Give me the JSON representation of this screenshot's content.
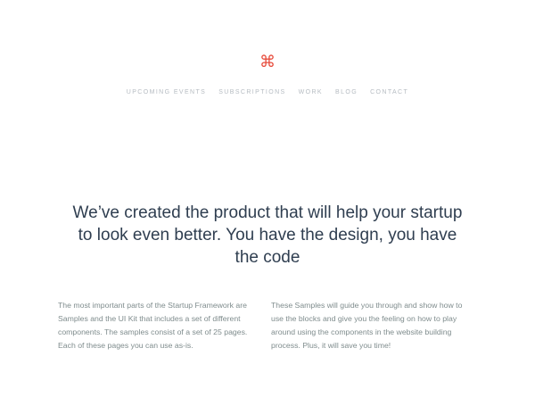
{
  "header": {
    "logo": "⌘"
  },
  "nav": {
    "items": [
      {
        "label": "UPCOMING EVENTS"
      },
      {
        "label": "SUBSCRIPTIONS"
      },
      {
        "label": "WORK"
      },
      {
        "label": "BLOG"
      },
      {
        "label": "CONTACT"
      }
    ]
  },
  "hero": {
    "headline": "We’ve created the product that will help your startup to look even better. You have the design, you have the code"
  },
  "columns": {
    "left": "The most important parts of the Startup Framework are Samples and the UI Kit that includes a set of different components. The samples consist of a set of 25 pages. Each of these pages you can use as-is.",
    "right": "These Samples will guide you through and show how to use the blocks and give you the feeling on how to play around using the components in the website building process. Plus, it will save you time!"
  },
  "colors": {
    "accent": "#e74c3c",
    "heading": "#2f3e50",
    "nav": "#b6bcc2",
    "body_text": "#7f8c8d"
  }
}
